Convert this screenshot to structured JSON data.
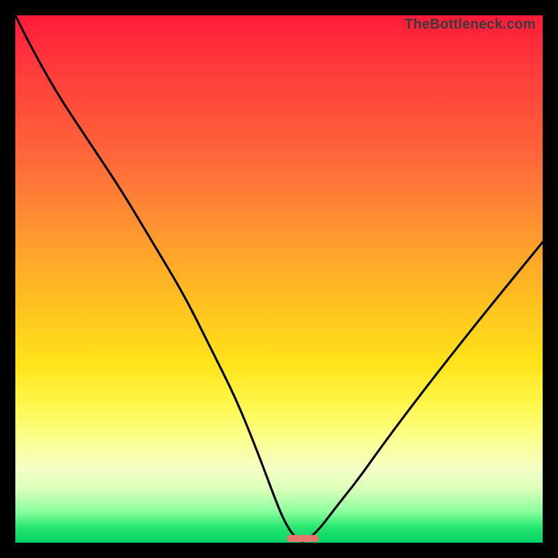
{
  "watermark": "TheBottleneck.com",
  "colors": {
    "frame": "#000000",
    "watermark": "#3a3a3a",
    "curve": "#000000",
    "marker": "#e8746c",
    "gradient_top": "#ff1a3a",
    "gradient_bottom": "#06d267"
  },
  "chart_data": {
    "type": "line",
    "title": "",
    "xlabel": "",
    "ylabel": "",
    "xlim": [
      0,
      100
    ],
    "ylim": [
      0,
      100
    ],
    "x": [
      0,
      3,
      8,
      14,
      20,
      26,
      32,
      37,
      42,
      46,
      49,
      51,
      53,
      54.5,
      56,
      58,
      61,
      65,
      70,
      76,
      83,
      91,
      100
    ],
    "values": [
      100,
      94,
      85,
      76,
      67,
      57,
      47,
      37,
      27,
      17,
      9,
      4,
      1,
      0,
      1,
      3,
      7,
      12,
      19,
      27,
      36,
      46,
      57
    ],
    "minimum": {
      "x": 54.5,
      "y": 0,
      "width_pct": 6
    },
    "notes": "y read as bottleneck percentage (0 at bottom green, 100 at top red). Values estimated from pixel positions; no axis ticks are rendered in the source image."
  }
}
